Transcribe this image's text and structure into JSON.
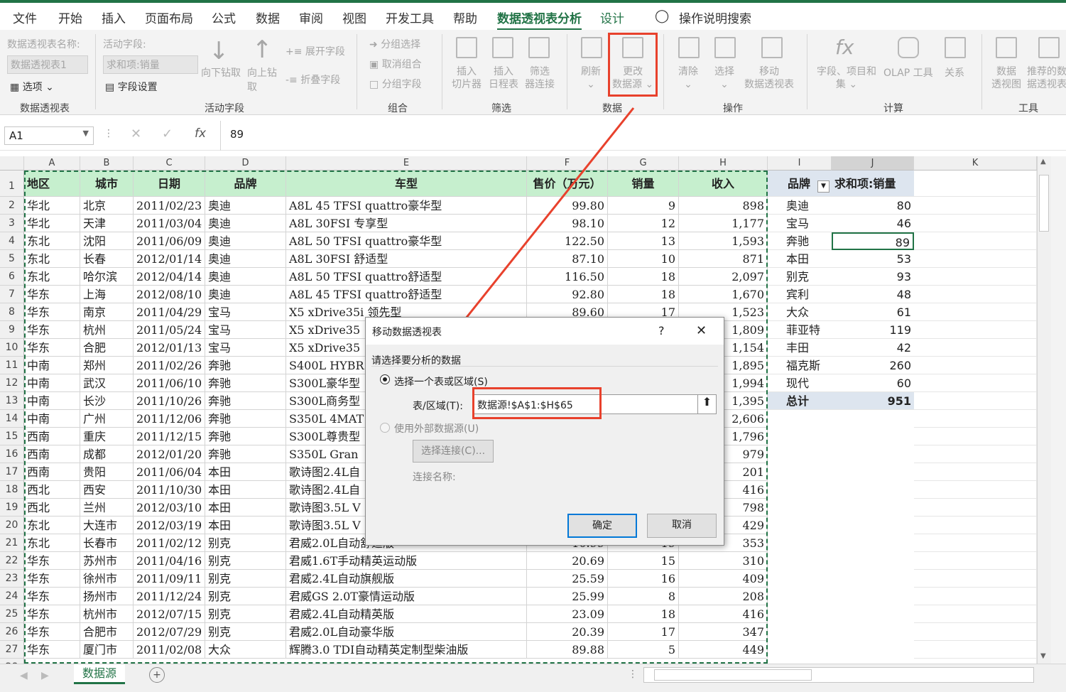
{
  "menu": [
    "文件",
    "开始",
    "插入",
    "页面布局",
    "公式",
    "数据",
    "审阅",
    "视图",
    "开发工具",
    "帮助",
    "数据透视表分析",
    "设计"
  ],
  "menu_search": "操作说明搜索",
  "ribbon": {
    "pivot_name_label": "数据透视表名称:",
    "pivot_name_value": "数据透视表1",
    "options_label": "选项",
    "active_field_label": "活动字段:",
    "active_field_value": "求和项:销量",
    "field_settings_label": "字段设置",
    "drill_down": "向下钻取",
    "drill_up": "向上钻取",
    "expand_field": "展开字段",
    "collapse_field": "折叠字段",
    "group_selection": "分组选择",
    "ungroup": "取消组合",
    "group_field": "分组字段",
    "insert_slicer": [
      "插入",
      "切片器"
    ],
    "insert_timeline": [
      "插入",
      "日程表"
    ],
    "filter_connections": [
      "筛选",
      "器连接"
    ],
    "refresh": "刷新",
    "change_source": [
      "更改",
      "数据源"
    ],
    "clear": "清除",
    "select": "选择",
    "move_pivot": [
      "移动",
      "数据透视表"
    ],
    "fields_items": [
      "字段、项目和",
      "集"
    ],
    "olap_tools": "OLAP 工具",
    "relationships": "关系",
    "pivot_chart": [
      "数据",
      "透视图"
    ],
    "recommended": [
      "推荐的数",
      "据透视表"
    ],
    "groups": [
      "数据透视表",
      "活动字段",
      "组合",
      "筛选",
      "数据",
      "操作",
      "计算",
      "工具"
    ]
  },
  "formula_bar": {
    "name_box": "A1",
    "fx": "fx",
    "value": "89"
  },
  "columns": [
    "A",
    "B",
    "C",
    "D",
    "E",
    "F",
    "G",
    "H",
    "I",
    "J",
    "K"
  ],
  "table_headers": [
    "地区",
    "城市",
    "日期",
    "品牌",
    "车型",
    "售价（万元）",
    "销量",
    "收入"
  ],
  "rows": [
    [
      "华北",
      "北京",
      "2011/02/23",
      "奥迪",
      "A8L 45 TFSI quattro豪华型",
      "99.80",
      "9",
      "898"
    ],
    [
      "华北",
      "天津",
      "2011/03/04",
      "奥迪",
      "A8L 30FSI 专享型",
      "98.10",
      "12",
      "1,177"
    ],
    [
      "东北",
      "沈阳",
      "2011/06/09",
      "奥迪",
      "A8L 50 TFSI quattro豪华型",
      "122.50",
      "13",
      "1,593"
    ],
    [
      "东北",
      "长春",
      "2012/01/14",
      "奥迪",
      "A8L 30FSI 舒适型",
      "87.10",
      "10",
      "871"
    ],
    [
      "东北",
      "哈尔滨",
      "2012/04/14",
      "奥迪",
      "A8L 50 TFSI quattro舒适型",
      "116.50",
      "18",
      "2,097"
    ],
    [
      "华东",
      "上海",
      "2012/08/10",
      "奥迪",
      "A8L 45 TFSI quattro舒适型",
      "92.80",
      "18",
      "1,670"
    ],
    [
      "华东",
      "南京",
      "2011/04/29",
      "宝马",
      "X5 xDrive35i 领先型",
      "89.60",
      "17",
      "1,523"
    ],
    [
      "华东",
      "杭州",
      "2011/05/24",
      "宝马",
      "X5 xDrive35",
      "",
      "",
      "1,809"
    ],
    [
      "华东",
      "合肥",
      "2012/01/13",
      "宝马",
      "X5 xDrive35",
      "",
      "",
      "1,154"
    ],
    [
      "中南",
      "郑州",
      "2011/02/26",
      "奔驰",
      "S400L HYBR",
      "",
      "",
      "1,895"
    ],
    [
      "中南",
      "武汉",
      "2011/06/10",
      "奔驰",
      "S300L豪华型",
      "",
      "",
      "1,994"
    ],
    [
      "中南",
      "长沙",
      "2011/10/26",
      "奔驰",
      "S300L商务型",
      "",
      "",
      "1,395"
    ],
    [
      "中南",
      "广州",
      "2011/12/06",
      "奔驰",
      "S350L 4MAT",
      "",
      "",
      "2,606"
    ],
    [
      "西南",
      "重庆",
      "2011/12/15",
      "奔驰",
      "S300L尊贵型",
      "",
      "",
      "1,796"
    ],
    [
      "西南",
      "成都",
      "2012/01/20",
      "奔驰",
      "S350L Gran",
      "",
      "",
      "979"
    ],
    [
      "西南",
      "贵阳",
      "2011/06/04",
      "本田",
      "歌诗图2.4L自",
      "",
      "",
      "201"
    ],
    [
      "西北",
      "西安",
      "2011/10/30",
      "本田",
      "歌诗图2.4L自",
      "",
      "",
      "416"
    ],
    [
      "西北",
      "兰州",
      "2012/03/10",
      "本田",
      "歌诗图3.5L V",
      "",
      "",
      "798"
    ],
    [
      "东北",
      "大连市",
      "2012/03/19",
      "本田",
      "歌诗图3.5L V",
      "",
      "",
      "429"
    ],
    [
      "东北",
      "长春市",
      "2011/02/12",
      "别克",
      "君威2.0L自动舒适版",
      "10.99",
      "19",
      "353"
    ],
    [
      "华东",
      "苏州市",
      "2011/04/16",
      "别克",
      "君威1.6T手动精英运动版",
      "20.69",
      "15",
      "310"
    ],
    [
      "华东",
      "徐州市",
      "2011/09/11",
      "别克",
      "君威2.4L自动旗舰版",
      "25.59",
      "16",
      "409"
    ],
    [
      "华东",
      "扬州市",
      "2011/12/24",
      "别克",
      "君威GS 2.0T豪情运动版",
      "25.99",
      "8",
      "208"
    ],
    [
      "华东",
      "杭州市",
      "2012/07/15",
      "别克",
      "君威2.4L自动精英版",
      "23.09",
      "18",
      "416"
    ],
    [
      "华东",
      "合肥市",
      "2012/07/29",
      "别克",
      "君威2.0L自动豪华版",
      "20.39",
      "17",
      "347"
    ],
    [
      "华东",
      "厦门市",
      "2011/02/08",
      "大众",
      "辉腾3.0 TDI自动精英定制型柴油版",
      "89.88",
      "5",
      "449"
    ]
  ],
  "pivot": {
    "header_brand": "品牌",
    "header_sum": "求和项:销量",
    "rows": [
      [
        "奥迪",
        "80"
      ],
      [
        "宝马",
        "46"
      ],
      [
        "奔驰",
        "89"
      ],
      [
        "本田",
        "53"
      ],
      [
        "别克",
        "93"
      ],
      [
        "宾利",
        "48"
      ],
      [
        "大众",
        "61"
      ],
      [
        "菲亚特",
        "119"
      ],
      [
        "丰田",
        "42"
      ],
      [
        "福克斯",
        "260"
      ],
      [
        "现代",
        "60"
      ]
    ],
    "total_label": "总计",
    "total_value": "951"
  },
  "dialog": {
    "title": "移动数据透视表",
    "help": "?",
    "close": "✕",
    "prompt": "请选择要分析的数据",
    "option_range": "选择一个表或区域(S)",
    "range_label": "表/区域(T):",
    "range_value": "数据源!$A$1:$H$65",
    "option_external": "使用外部数据源(U)",
    "choose_conn": "选择连接(C)...",
    "conn_name": "连接名称:",
    "ok": "确定",
    "cancel": "取消"
  },
  "sheet_tab": "数据源",
  "colors": {
    "accent": "#217346",
    "header_fill": "#c6efce",
    "highlight": "#e8412c",
    "pivot_header": "#dde5ef"
  }
}
